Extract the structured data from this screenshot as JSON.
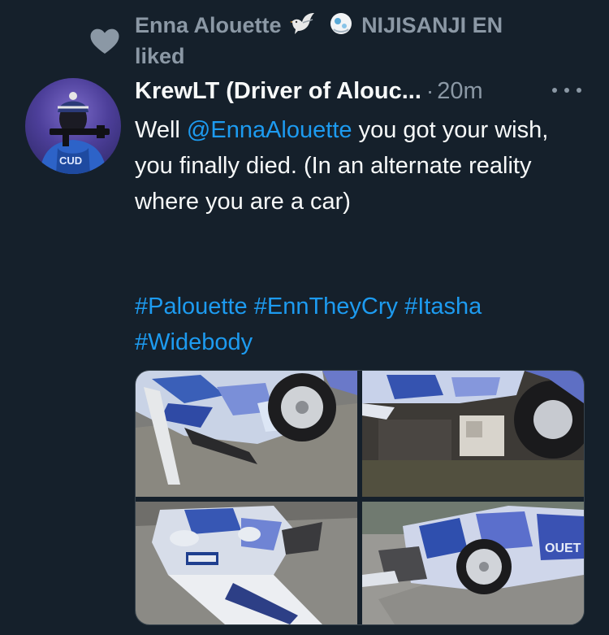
{
  "social_context": {
    "name": "Enna Alouette",
    "suffix": "NIJISANJI EN liked",
    "icons": [
      "dove-icon",
      "moon-icon"
    ]
  },
  "tweet": {
    "author": "KrewLT (Driver of Alouc...",
    "separator": "·",
    "time": "20m",
    "text_before": "Well ",
    "mention": "@EnnaAlouette",
    "text_after": " you got your wish, you finally died. (In an alternate reality where you are a car)",
    "hashtags": [
      "#Palouette",
      "#EnnTheyCry",
      "#Itasha",
      "#Widebody"
    ]
  },
  "colors": {
    "background": "#15202b",
    "link": "#1d9bf0",
    "muted": "#8b98a5",
    "text": "#f7f9f9"
  }
}
